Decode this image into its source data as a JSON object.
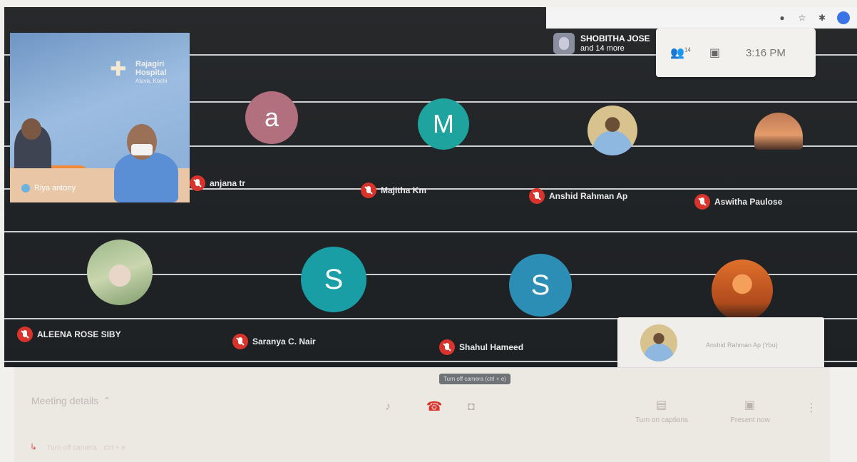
{
  "header": {
    "presenter_name": "SHOBITHA JOSE",
    "presenter_sub": "and 14 more",
    "people_count": "14",
    "time": "3:16 PM"
  },
  "presenter_tile": {
    "banner_title": "Rajagiri Hospital",
    "banner_sub": "Aluva, Kochi",
    "name": "Riya antony"
  },
  "participants": [
    {
      "initial": "a",
      "name": "anjana tr",
      "color": "#b26f7d"
    },
    {
      "initial": "M",
      "name": "Majitha Km",
      "color": "#1fa39e"
    },
    {
      "initial": "",
      "name": "Anshid Rahman Ap",
      "color": "#d8c38f"
    },
    {
      "initial": "",
      "name": "Aswitha Paulose",
      "color": "#c07b56"
    },
    {
      "initial": "",
      "name": "ALEENA ROSE SIBY",
      "color": "#b8c7a2"
    },
    {
      "initial": "S",
      "name": "Saranya C. Nair",
      "color": "#1a9ea6"
    },
    {
      "initial": "S",
      "name": "Shahul Hameed",
      "color": "#2c8eb4"
    },
    {
      "initial": "",
      "name": "",
      "color": "#e0702c"
    }
  ],
  "self_view": {
    "label": "Anshid Rahman Ap (You)"
  },
  "tooltip": "Turn off camera (ctrl + e)",
  "toolbar": {
    "meeting_details": "Meeting details",
    "captions_label": "Turn on captions",
    "present_label": "Present now",
    "warning": "Turn off camera",
    "warning_sub": "ctrl + e"
  },
  "icons": {
    "chevron": "chevron-up-icon",
    "mic": "mic-icon",
    "end_call": "end-call-icon",
    "camera": "camera-icon"
  }
}
